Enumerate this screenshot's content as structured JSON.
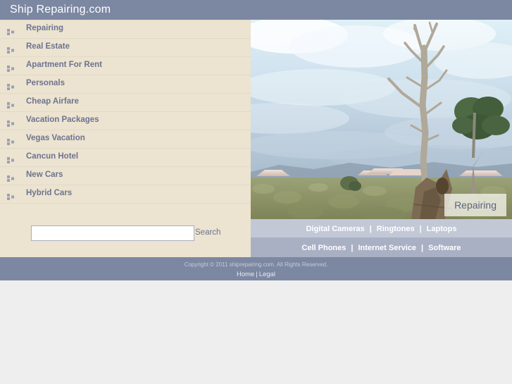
{
  "header": {
    "title": "Ship Repairing.com",
    "background_color": "#7c87a2"
  },
  "sidebar": {
    "background_color": "#ece3d0",
    "bullet_icon": "three-squares-bullet-icon",
    "items": [
      {
        "label": "Repairing"
      },
      {
        "label": "Real Estate"
      },
      {
        "label": "Apartment For Rent"
      },
      {
        "label": "Personals"
      },
      {
        "label": "Cheap Airfare"
      },
      {
        "label": "Vacation Packages"
      },
      {
        "label": "Vegas Vacation"
      },
      {
        "label": "Cancun Hotel"
      },
      {
        "label": "New Cars"
      },
      {
        "label": "Hybrid Cars"
      }
    ]
  },
  "search": {
    "value": "",
    "placeholder": "",
    "button_label": "Search"
  },
  "hero": {
    "caption": "Repairing",
    "alt": "desert landscape with dead tree and mesas"
  },
  "sub_nav_rows": [
    {
      "background_color": "#c2c8d6",
      "items": [
        "Digital Cameras",
        "Ringtones",
        "Laptops"
      ],
      "separator": "|"
    },
    {
      "background_color": "#a9b0c4",
      "items": [
        "Cell Phones",
        "Internet Service",
        "Software"
      ],
      "separator": "|"
    }
  ],
  "footer": {
    "copyright": "Copyright © 2011 shiprepairing.com. All Rights Reserved.",
    "links": [
      "Home",
      "Legal"
    ],
    "separator": "|",
    "background_color": "#7c87a2"
  }
}
